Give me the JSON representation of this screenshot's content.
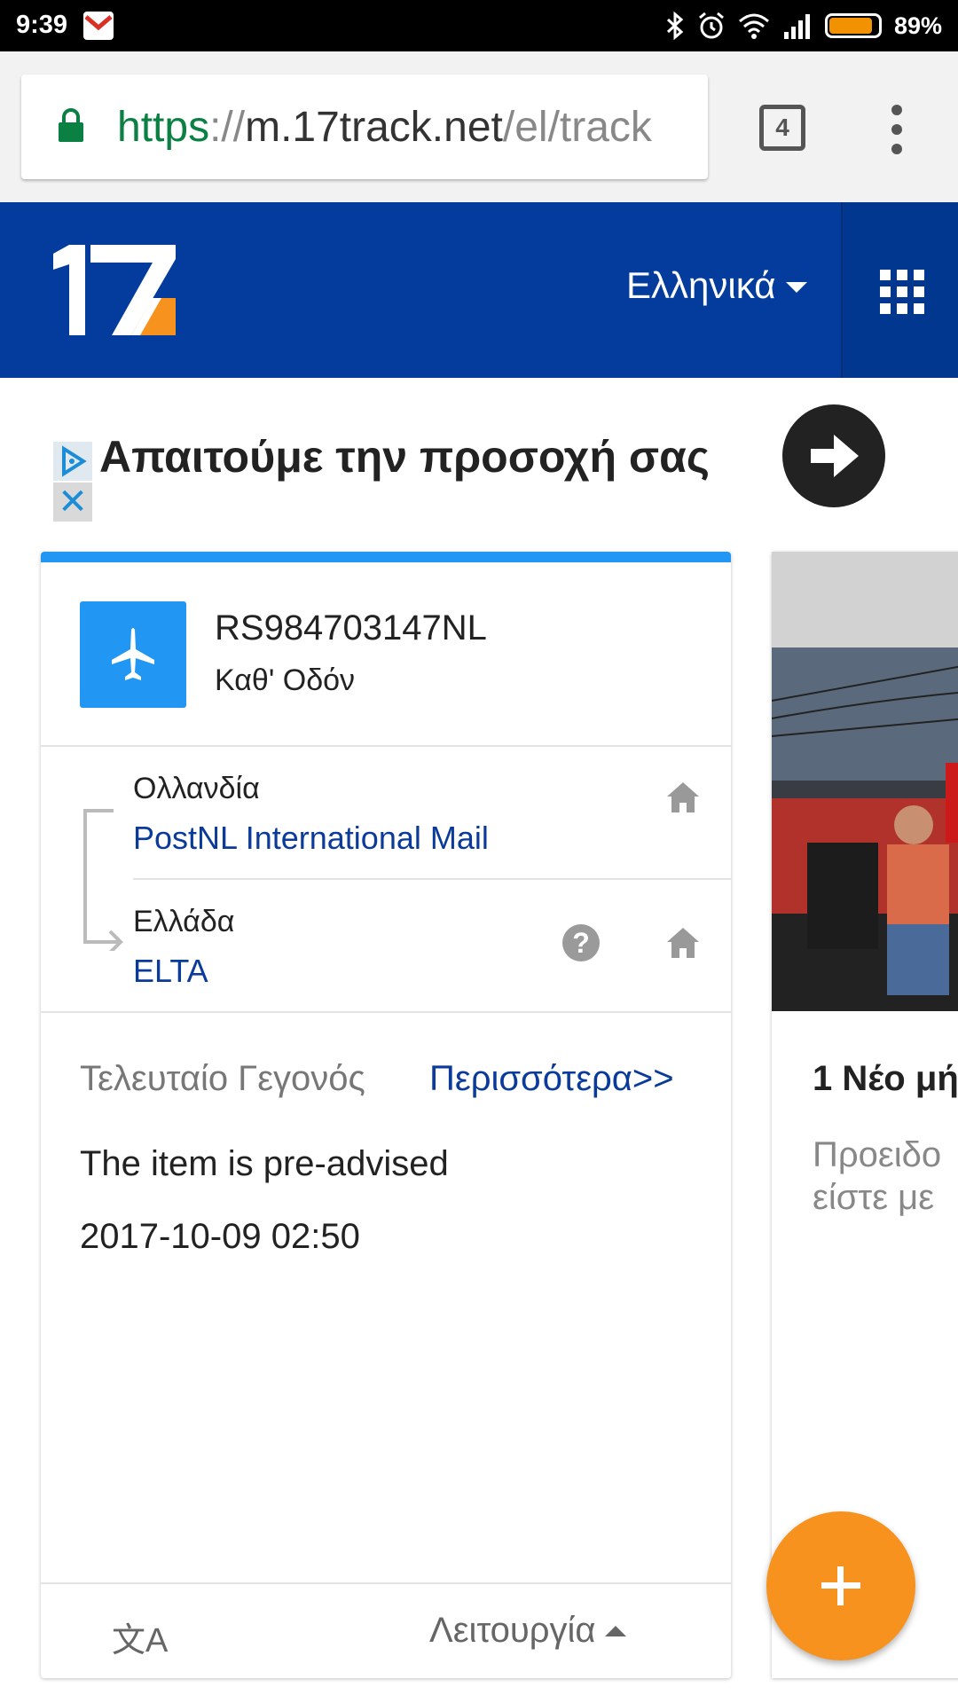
{
  "status_bar": {
    "time": "9:39",
    "battery": "89%",
    "battery_level": 0.89,
    "colors": {
      "battery_fill": "#f39200"
    }
  },
  "browser": {
    "url_scheme": "https",
    "url_sep": "://",
    "url_host": "m.17track.net",
    "url_path": "/el/track",
    "tab_count": "4"
  },
  "header": {
    "logo_text": "17",
    "language": "Ελληνικά",
    "colors": {
      "bar": "#033c9c",
      "accent": "#f7921e"
    }
  },
  "ad": {
    "title": "Απαιτούμε την προσοχή σας",
    "close_glyph": "✕"
  },
  "tracking": {
    "number": "RS984703147NL",
    "status": "Καθ' Οδόν",
    "origin": {
      "country": "Ολλανδία",
      "carrier": "PostNL International Mail"
    },
    "destination": {
      "country": "Ελλάδα",
      "carrier": "ELTA"
    },
    "help_glyph": "?",
    "last_event_label": "Τελευταίο Γεγονός",
    "more_link": "Περισσότερα>>",
    "last_event": "The item is pre-advised",
    "last_event_time": "2017-10-09 02:50",
    "footer_function": "Λειτουργία",
    "translate_glyph": "文A"
  },
  "side_card": {
    "headline": "1 Νέο μή",
    "desc_line1": "Προειδο",
    "desc_line2": "είστε με"
  },
  "icons": [
    "gmail-icon",
    "bluetooth-icon",
    "alarm-icon",
    "wifi-icon",
    "signal-icon",
    "battery-icon",
    "lock-icon",
    "menu-dots-icon",
    "apps-grid-icon",
    "adchoices-icon",
    "arrow-right-icon",
    "plane-icon",
    "home-icon",
    "help-icon",
    "translate-icon",
    "plus-icon"
  ]
}
